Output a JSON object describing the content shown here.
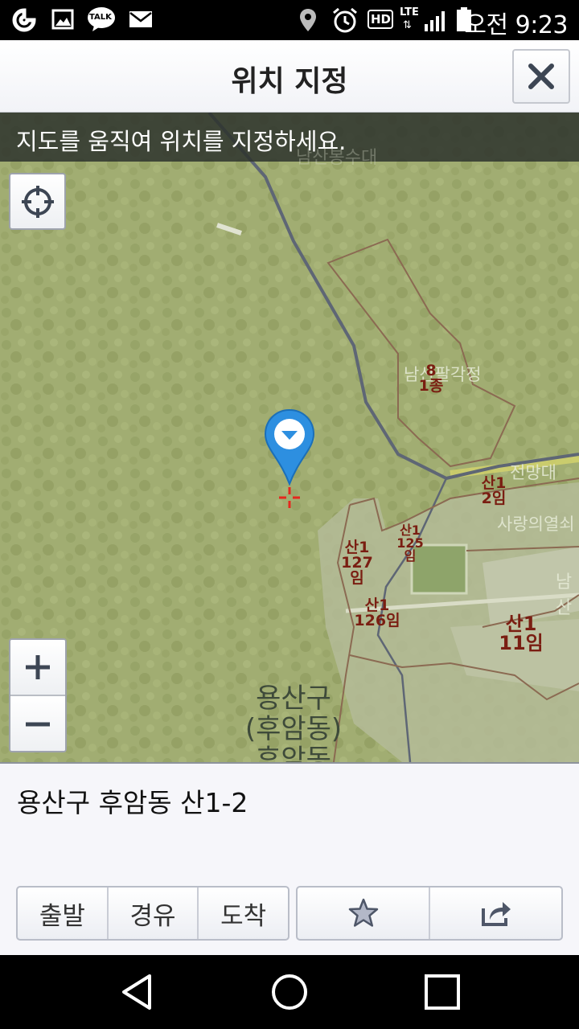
{
  "status_bar": {
    "time": "오전 9:23",
    "icons": [
      "olleh-icon",
      "gallery-icon",
      "kakaotalk-icon",
      "mail-icon",
      "location-icon",
      "alarm-icon",
      "hd-icon",
      "lte-icon",
      "signal-icon",
      "battery-icon"
    ],
    "talk_label": "TALK",
    "hd_label": "HD",
    "lte_label": "LTE"
  },
  "header": {
    "title": "위치 지정",
    "close_icon": "close-icon"
  },
  "map": {
    "hint": "지도를 움직여 위치를 지정하세요.",
    "labels": [
      {
        "id": "l1",
        "line1": "8",
        "line2": "1종"
      },
      {
        "id": "l2",
        "line1": "산1",
        "line2": "2임"
      },
      {
        "id": "l3",
        "line1": "산1",
        "line2": "125임"
      },
      {
        "id": "l4",
        "line1": "산1",
        "line2": "127임"
      },
      {
        "id": "l5",
        "line1": "산1",
        "line2": "126임"
      },
      {
        "id": "l6",
        "line1": "산1",
        "line2": "11임"
      }
    ],
    "pale_labels": {
      "top": "남산봉수대",
      "pavilion": "남산팔각정",
      "observatory": "전망대",
      "shrine": "사랑의열쇠",
      "right": "남산"
    },
    "district": {
      "line1": "용산구",
      "line2": "(후암동)",
      "line3": "후암동"
    },
    "accent_color": "#2d8fe0",
    "crosshair_color": "#e5281e"
  },
  "panel": {
    "address": "용산구 후암동 산1-2",
    "buttons": {
      "start": "출발",
      "via": "경유",
      "arrive": "도착"
    },
    "icons": [
      "star-icon",
      "share-icon"
    ]
  },
  "nav": {
    "icons": [
      "back-icon",
      "home-icon",
      "recents-icon"
    ]
  }
}
